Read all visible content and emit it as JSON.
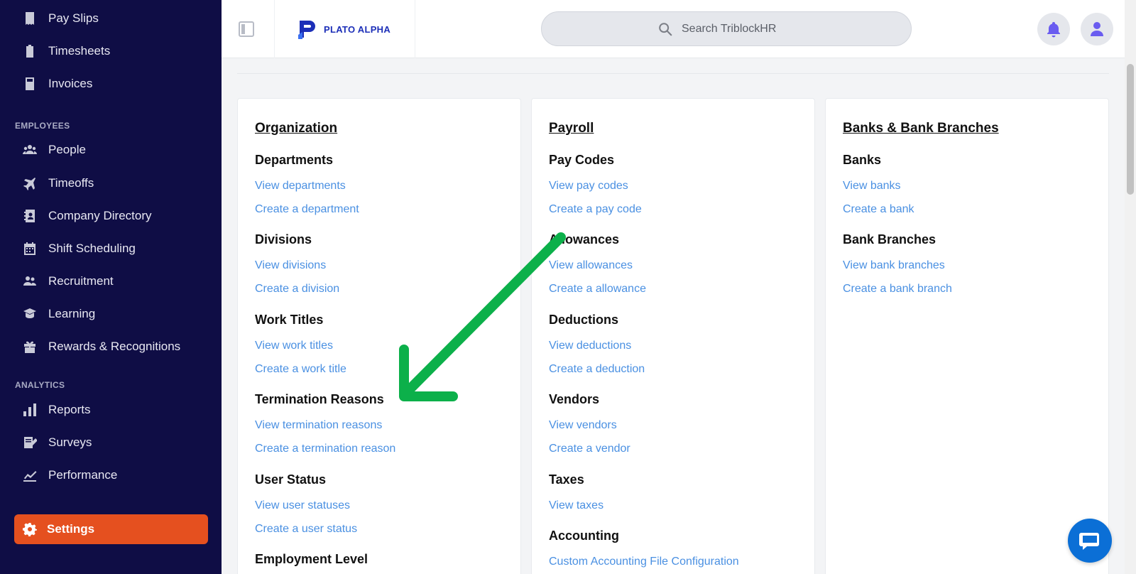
{
  "sidebar": {
    "items_top": [
      {
        "label": "Pay Slips",
        "icon": "receipt-icon"
      },
      {
        "label": "Timesheets",
        "icon": "clipboard-icon"
      },
      {
        "label": "Invoices",
        "icon": "calculator-icon"
      }
    ],
    "section_employees": "EMPLOYEES",
    "items_employees": [
      {
        "label": "People",
        "icon": "users-icon"
      },
      {
        "label": "Timeoffs",
        "icon": "plane-icon"
      },
      {
        "label": "Company Directory",
        "icon": "contact-book-icon"
      },
      {
        "label": "Shift Scheduling",
        "icon": "calendar-icon"
      },
      {
        "label": "Recruitment",
        "icon": "user-handshake-icon"
      },
      {
        "label": "Learning",
        "icon": "graduation-icon"
      },
      {
        "label": "Rewards & Recognitions",
        "icon": "gift-icon"
      }
    ],
    "section_analytics": "ANALYTICS",
    "items_analytics": [
      {
        "label": "Reports",
        "icon": "bar-chart-icon"
      },
      {
        "label": "Surveys",
        "icon": "survey-icon"
      },
      {
        "label": "Performance",
        "icon": "line-chart-icon"
      }
    ],
    "settings_label": "Settings",
    "accent_color": "#e5501f",
    "background_color": "#0f0d45"
  },
  "header": {
    "logo_text": "PLATO ALPHA",
    "search_placeholder": "Search TriblockHR"
  },
  "cards": [
    {
      "title": "Organization",
      "groups": [
        {
          "title": "Departments",
          "links": [
            "View departments",
            "Create a department"
          ]
        },
        {
          "title": "Divisions",
          "links": [
            "View divisions",
            "Create a division"
          ]
        },
        {
          "title": "Work Titles",
          "links": [
            "View work titles",
            "Create a work title"
          ]
        },
        {
          "title": "Termination Reasons",
          "links": [
            "View termination reasons",
            "Create a termination reason"
          ]
        },
        {
          "title": "User Status",
          "links": [
            "View user statuses",
            "Create a user status"
          ]
        },
        {
          "title": "Employment Level",
          "links": []
        }
      ]
    },
    {
      "title": "Payroll",
      "groups": [
        {
          "title": "Pay Codes",
          "links": [
            "View pay codes",
            "Create a pay code"
          ]
        },
        {
          "title": "Allowances",
          "links": [
            "View allowances",
            "Create a allowance"
          ]
        },
        {
          "title": "Deductions",
          "links": [
            "View deductions",
            "Create a deduction"
          ]
        },
        {
          "title": "Vendors",
          "links": [
            "View vendors",
            "Create a vendor"
          ]
        },
        {
          "title": "Taxes",
          "links": [
            "View taxes"
          ]
        },
        {
          "title": "Accounting",
          "links": [
            "Custom Accounting File Configuration"
          ]
        }
      ]
    },
    {
      "title": "Banks & Bank Branches",
      "groups": [
        {
          "title": "Banks",
          "links": [
            "View banks",
            "Create a bank"
          ]
        },
        {
          "title": "Bank Branches",
          "links": [
            "View bank branches",
            "Create a bank branch"
          ]
        }
      ]
    }
  ],
  "annotation": {
    "type": "arrow",
    "color": "#0cb04a",
    "points_to": "Termination Reasons"
  },
  "link_color": "#4a90e2"
}
